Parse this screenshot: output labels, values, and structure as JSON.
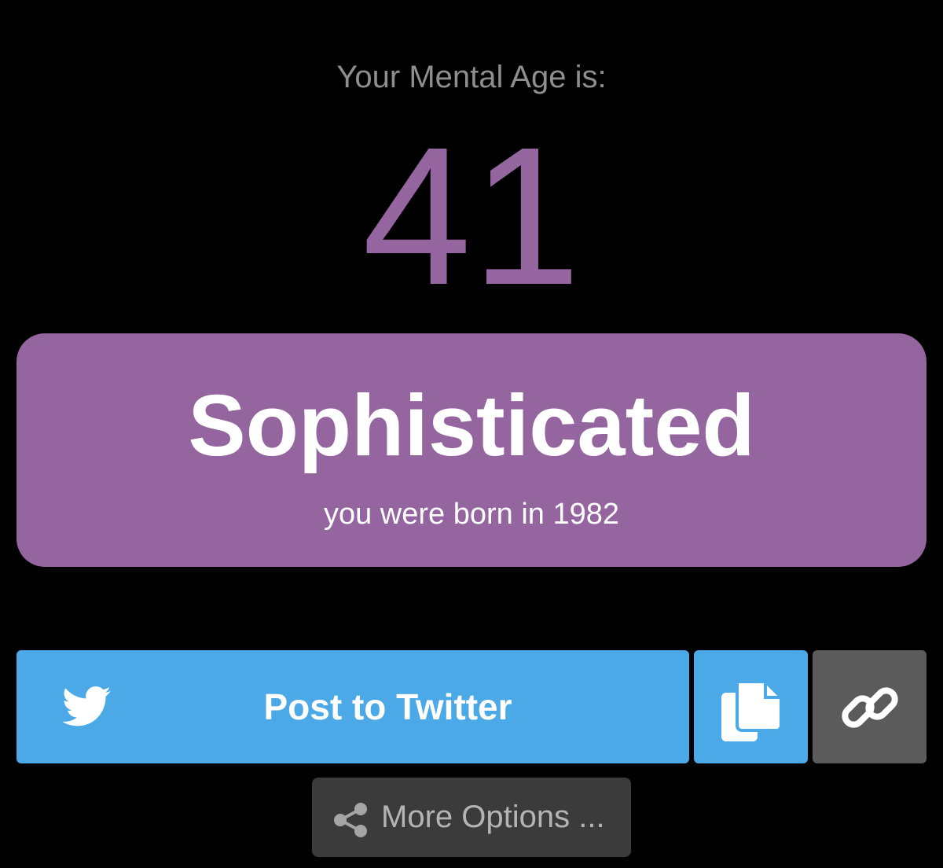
{
  "header": {
    "heading": "Your Mental Age is:",
    "age_value": "41"
  },
  "result": {
    "title": "Sophisticated",
    "subtitle": "you were born in 1982"
  },
  "actions": {
    "twitter_label": "Post to Twitter",
    "twitter_icon": "twitter-bird-icon",
    "copy_icon": "copy-icon",
    "link_icon": "link-icon",
    "more_label": "More Options ...",
    "more_icon": "share-icon"
  },
  "colors": {
    "background": "#000000",
    "accent_purple": "#9565a0",
    "twitter_blue": "#4ba9e7",
    "link_gray": "#5b5b5b",
    "more_gray": "#3b3b3b",
    "heading_gray": "#8e8e8e"
  }
}
